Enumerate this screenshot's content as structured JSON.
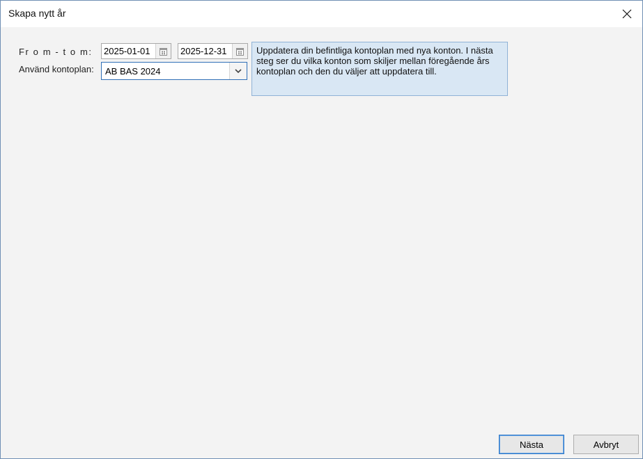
{
  "window": {
    "title": "Skapa nytt år"
  },
  "form": {
    "period_label": "Fr o m - t o m:",
    "date_from": "2025-01-01",
    "date_to": "2025-12-31",
    "kontoplan_label": "Använd kontoplan:",
    "kontoplan_value": "AB BAS 2024"
  },
  "info": {
    "text": "Uppdatera din befintliga kontoplan med nya konton. I nästa steg ser du vilka konton som skiljer mellan föregående års kontoplan och den du väljer att uppdatera till."
  },
  "buttons": {
    "next": "Nästa",
    "cancel": "Avbryt"
  },
  "icons": {
    "close": "close-icon",
    "calendar": "calendar-icon",
    "dropdown": "chevron-down-icon"
  },
  "colors": {
    "accent": "#2f6fb7",
    "info_bg": "#d9e7f4",
    "info_border": "#8fb2d6",
    "window_bg": "#f3f3f3"
  }
}
